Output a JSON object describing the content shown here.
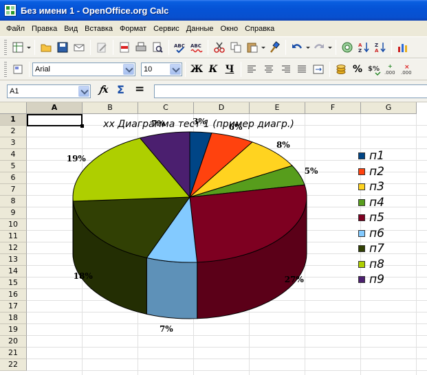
{
  "window": {
    "title": "Без имени 1 - OpenOffice.org Calc"
  },
  "menu": [
    "Файл",
    "Правка",
    "Вид",
    "Вставка",
    "Формат",
    "Сервис",
    "Данные",
    "Окно",
    "Справка"
  ],
  "toolbar1": {
    "icons": [
      "new-icon",
      "open-icon",
      "save-icon",
      "email-icon",
      "edit-file-icon",
      "export-pdf-icon",
      "print-icon",
      "page-preview-icon",
      "spellcheck-icon",
      "autospellcheck-icon",
      "cut-icon",
      "copy-icon",
      "paste-icon",
      "format-paintbrush-icon",
      "undo-icon",
      "redo-icon",
      "navigator-icon",
      "sort-ascending-icon",
      "sort-descending-icon",
      "chart-icon"
    ]
  },
  "toolbar2": {
    "font_name": "Arial",
    "font_size": "10",
    "bold_label": "Ж",
    "italic_label": "К",
    "underline_label": "Ч"
  },
  "formula_bar": {
    "cell_ref": "A1",
    "formula": ""
  },
  "sheet": {
    "columns": [
      "A",
      "B",
      "C",
      "D",
      "E",
      "F",
      "G"
    ],
    "rows": [
      "1",
      "2",
      "3",
      "4",
      "5",
      "6",
      "7",
      "8",
      "9",
      "10",
      "11",
      "12",
      "13",
      "14",
      "15",
      "16",
      "17",
      "18",
      "19",
      "20",
      "21",
      "22"
    ],
    "active_cell": "A1"
  },
  "chart_data": {
    "type": "pie",
    "style": "3d",
    "title": "xx Диаграмма тест 1 (пример диагр.)",
    "categories": [
      "п1",
      "п2",
      "п3",
      "п4",
      "п5",
      "п6",
      "п7",
      "п8",
      "п9"
    ],
    "values": [
      3,
      6,
      8,
      5,
      27,
      7,
      18,
      19,
      7
    ],
    "labels": [
      "3%",
      "6%",
      "8%",
      "5%",
      "27%",
      "7%",
      "18%",
      "19%",
      "7%"
    ],
    "colors": [
      "#004586",
      "#ff420e",
      "#ffd320",
      "#579d1c",
      "#7e0021",
      "#83caff",
      "#314004",
      "#aecf00",
      "#4b1f6f"
    ],
    "legend_position": "right"
  }
}
